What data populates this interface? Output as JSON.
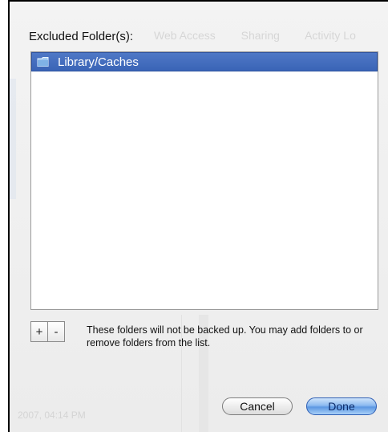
{
  "dialog": {
    "title": "Excluded Folder(s):",
    "background_tabs": [
      "Web Access",
      "Sharing",
      "Activity Lo"
    ],
    "background_fragments": [
      "2007, 04:14 PM"
    ],
    "list": {
      "items": [
        {
          "label": "Library/Caches",
          "icon": "folder-icon",
          "selected": true
        }
      ]
    },
    "add_label": "+",
    "remove_label": "-",
    "note": "These folders will not be backed up. You may add folders to or remove folders from the list.",
    "cancel_label": "Cancel",
    "done_label": "Done"
  },
  "colors": {
    "selection": "#3a64b6",
    "default_button": "#5c97e2"
  }
}
